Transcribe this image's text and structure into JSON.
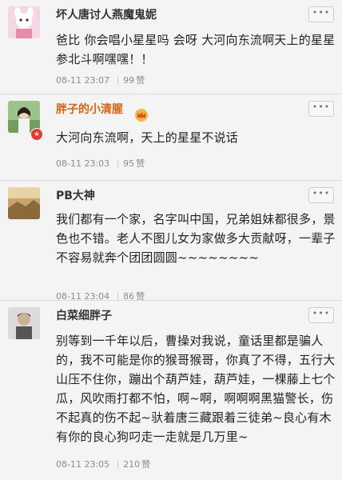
{
  "comments": [
    {
      "username": "坏人唐讨人燕魔鬼妮",
      "text": "爸比 你会唱小星星吗 会呀 大河向东流啊天上的星星参北斗啊嘿嘿！！",
      "date": "08-11 23:07",
      "likes": "99",
      "likes_word": "赞",
      "more": "•••"
    },
    {
      "username": "胖子的小清腥",
      "text": "大河向东流啊，天上的星星不说话",
      "date": "08-11 23:03",
      "likes": "95",
      "likes_word": "赞",
      "more": "•••"
    },
    {
      "username": "PB大神",
      "text": "我们都有一个家，名字叫中国，兄弟姐妹都很多，景色也不错。老人不图儿女为家做多大贡献呀，一辈子不容易就奔个团团圆圆~~~~~~~~",
      "date": "08-11 23:04",
      "likes": "86",
      "likes_word": "赞",
      "more": "•••"
    },
    {
      "username": "白菜细胖子",
      "text": "别等到一千年以后，曹操对我说，童话里都是骗人的，我不可能是你的猴哥猴哥，你真了不得，五行大山压不住你，蹦出个葫芦娃，葫芦娃，一棵藤上七个瓜，风吹雨打都不怕，啊~啊，啊啊啊黑猫警长，伤不起真的伤不起~驮着唐三藏跟着三徒弟~良心有木有你的良心狗叼走一走就是几万里~",
      "date": "08-11 23:05",
      "likes": "210",
      "likes_word": "赞",
      "more": "•••"
    }
  ],
  "colors": {
    "vip_name": "#e0620f",
    "badge": "#e53935"
  },
  "icons": [
    "avatar-cartoon",
    "avatar-photo-girl",
    "avatar-landscape",
    "avatar-man",
    "crown-icon",
    "verified-badge-icon",
    "more-icon"
  ]
}
